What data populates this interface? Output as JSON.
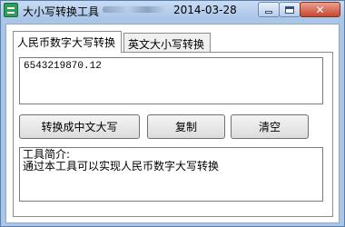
{
  "window": {
    "title": "大小写转换工具",
    "date": "2014-03-28",
    "close_glyph": "✕"
  },
  "tabs": [
    {
      "label": "人民币数字大写转换",
      "active": true
    },
    {
      "label": "英文大小写转换",
      "active": false
    }
  ],
  "input": {
    "value": "6543219870.12"
  },
  "buttons": {
    "convert_label": "转换成中文大写",
    "copy_label": "复制",
    "clear_label": "清空"
  },
  "info": {
    "heading": "工具简介:",
    "text": "通过本工具可以实现人民币数字大写转换"
  },
  "colors": {
    "titlebar": "#a9c5e8",
    "close_button": "#c6472e",
    "app_icon": "#2e9e5a"
  },
  "icons": {
    "app": "app-icon",
    "minimize": "minimize-icon",
    "maximize": "maximize-icon",
    "close": "close-icon"
  }
}
